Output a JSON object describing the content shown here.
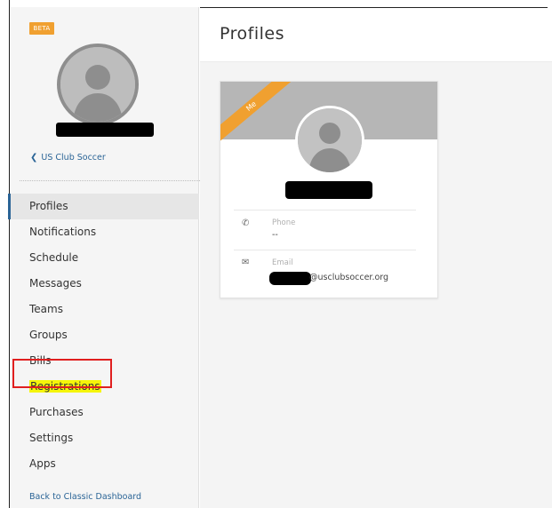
{
  "sidebar": {
    "badge": "BETA",
    "back_link": "US Club Soccer",
    "items": [
      {
        "label": "Profiles"
      },
      {
        "label": "Notifications"
      },
      {
        "label": "Schedule"
      },
      {
        "label": "Messages"
      },
      {
        "label": "Teams"
      },
      {
        "label": "Groups"
      },
      {
        "label": "Bills"
      },
      {
        "label": "Registrations"
      },
      {
        "label": "Purchases"
      },
      {
        "label": "Settings"
      },
      {
        "label": "Apps"
      }
    ],
    "classic_link": "Back to Classic Dashboard"
  },
  "main": {
    "title": "Profiles",
    "card": {
      "ribbon": "Me",
      "phone_label": "Phone",
      "phone_value": "--",
      "email_label": "Email",
      "email_value": "@usclubsoccer.org"
    }
  },
  "colors": {
    "accent": "#f0a030",
    "link": "#2a6496",
    "highlight": "#f5f50a",
    "annotation": "#e01f1f"
  },
  "icons": {
    "back": "chevron-left-icon",
    "phone": "phone-icon",
    "email": "envelope-icon",
    "avatar": "person-silhouette-icon"
  }
}
